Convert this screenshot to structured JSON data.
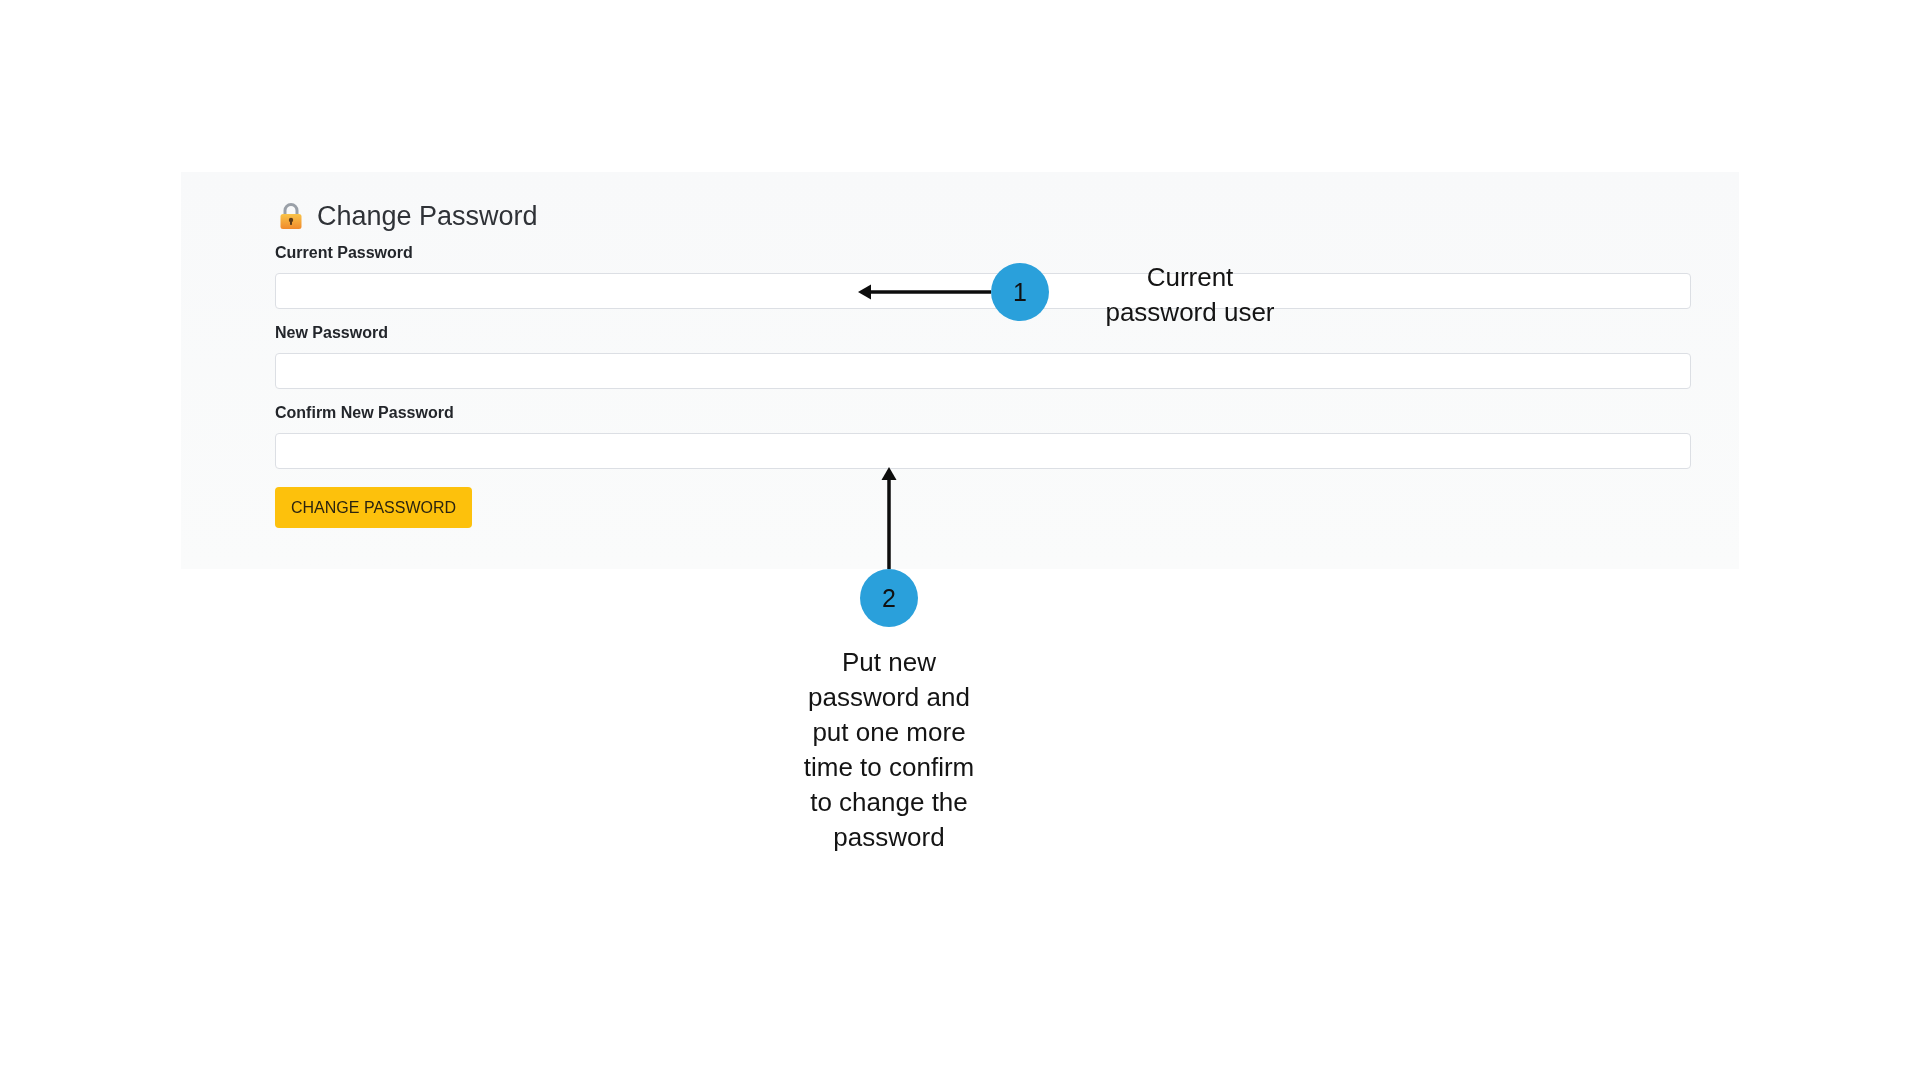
{
  "form": {
    "title": "Change Password",
    "fields": [
      {
        "label": "Current Password"
      },
      {
        "label": "New Password"
      },
      {
        "label": "Confirm New Password"
      }
    ],
    "submit_button": "CHANGE PASSWORD"
  },
  "annotations": [
    {
      "number": "1",
      "text": "Current password user"
    },
    {
      "number": "2",
      "text": "Put new password and put one more time to confirm to change the password"
    }
  ]
}
